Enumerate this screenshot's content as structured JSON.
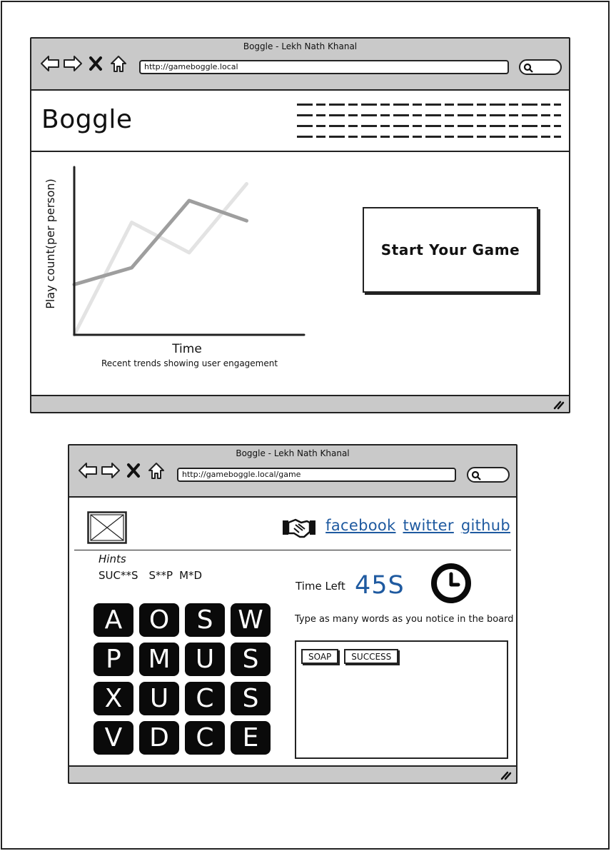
{
  "home_window": {
    "title": "Boggle - Lekh Nath Khanal",
    "url": "http://gameboggle.local",
    "app_title": "Boggle",
    "chart_caption": "Recent trends showing user engagement",
    "start_button": "Start Your Game"
  },
  "chart_data": {
    "type": "line",
    "title": "",
    "xlabel": "Time",
    "ylabel": "Play count(per person)",
    "x": [
      0,
      1,
      2,
      3,
      4
    ],
    "series": [
      {
        "values": [
          0.3,
          0.4,
          0.8,
          0.68
        ],
        "color": "#9e9e9e"
      },
      {
        "values": [
          0.0,
          0.67,
          0.49,
          0.9
        ],
        "color": "#e3e3e3"
      }
    ],
    "ylim": [
      0,
      1
    ],
    "grid": false,
    "legend": "none"
  },
  "game_window": {
    "title": "Boggle - Lekh Nath Khanal",
    "url": "http://gameboggle.local/game",
    "social": {
      "facebook": "facebook",
      "twitter": "twitter",
      "github": "github"
    },
    "hints_label": "Hints",
    "hints": [
      "SUC**S",
      "S**P",
      "M*D"
    ],
    "time_label": "Time Left",
    "time_value": "45S",
    "instructions": "Type as many words as you notice in the board",
    "board": [
      [
        "A",
        "O",
        "S",
        "W"
      ],
      [
        "P",
        "M",
        "U",
        "S"
      ],
      [
        "X",
        "U",
        "C",
        "S"
      ],
      [
        "V",
        "D",
        "C",
        "E"
      ]
    ],
    "found_words": [
      "SOAP",
      "SUCCESS"
    ]
  },
  "colors": {
    "titlebar": "#c9c9c9",
    "link": "#1f5aa0",
    "tile": "#0a0a0a"
  }
}
